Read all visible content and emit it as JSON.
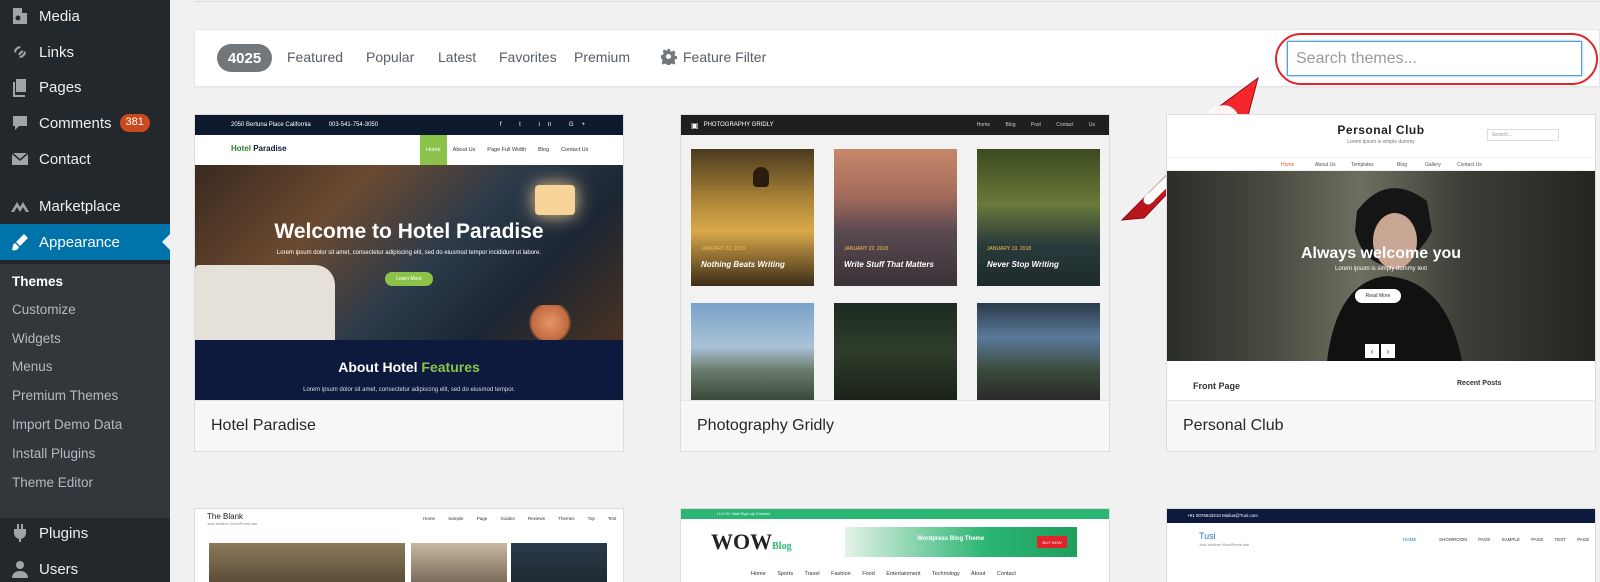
{
  "sidebar": {
    "items": [
      {
        "label": "Media",
        "icon": "media-icon"
      },
      {
        "label": "Links",
        "icon": "link-icon"
      },
      {
        "label": "Pages",
        "icon": "pages-icon"
      },
      {
        "label": "Comments",
        "icon": "comment-icon",
        "badge": "381"
      },
      {
        "label": "Contact",
        "icon": "mail-icon"
      },
      {
        "label": "Marketplace",
        "icon": "marketplace-icon"
      },
      {
        "label": "Appearance",
        "icon": "brush-icon"
      },
      {
        "label": "Plugins",
        "icon": "plugin-icon"
      },
      {
        "label": "Users",
        "icon": "user-icon"
      }
    ],
    "appearance_submenu": [
      "Themes",
      "Customize",
      "Widgets",
      "Menus",
      "Premium Themes",
      "Import Demo Data",
      "Install Plugins",
      "Theme Editor"
    ]
  },
  "filterbar": {
    "count": "4025",
    "tabs": [
      "Featured",
      "Popular",
      "Latest",
      "Favorites",
      "Premium"
    ],
    "feature_filter": "Feature Filter",
    "search_placeholder": "Search themes..."
  },
  "colors": {
    "sidebar_bg": "#23282d",
    "accent": "#0073aa",
    "badge": "#ca4a1f",
    "annotation_red": "#e2242a"
  },
  "themes": [
    {
      "name": "Hotel Paradise",
      "preview": {
        "topbar_address": "2050 Bertuna Place California",
        "topbar_phone": "003-541-754-3050",
        "social": "f t in G+",
        "logo_a": "Hotel",
        "logo_b": " Paradise",
        "nav": [
          "Home",
          "About Us",
          "Page Full Width",
          "Blog",
          "Contact Us"
        ],
        "hero_title": "Welcome to Hotel Paradise",
        "hero_text": "Lorem ipsum dolor sit amet, consectetur adipiscing elit, sed do eiusmod tempor incididunt ut labore.",
        "hero_button": "Learn More",
        "about_title_a": "About Hotel ",
        "about_title_b": "Features",
        "about_text": "Lorem ipsum dolor sit amet, consectetur adipiscing elit, sed do eiusmod tempor."
      }
    },
    {
      "name": "Photography Gridly",
      "preview": {
        "brand": "PHOTOGRAPHY GRIDLY",
        "nav": "Home Blog Post Contact Us",
        "tiles": [
          {
            "date": "JANUARY 22, 2018",
            "title": "Nothing Beats Writing"
          },
          {
            "date": "JANUARY 22, 2018",
            "title": "Write Stuff That Matters"
          },
          {
            "date": "JANUARY 19, 2018",
            "title": "Never Stop Writing"
          }
        ]
      }
    },
    {
      "name": "Personal Club",
      "preview": {
        "title": "Personal Club",
        "tagline": "Lorem ipsum is simple dummy",
        "search": "Search...",
        "nav": [
          "Home",
          "About Us",
          "Templates",
          "Blog",
          "Gallery",
          "Contact Us"
        ],
        "hero_title": "Always welcome you",
        "hero_text": "Lorem ipsum is simply dummy text",
        "hero_button": "Read More",
        "front_page": "Front Page",
        "recent_posts": "Recent Posts"
      }
    }
  ],
  "row2": [
    {
      "logo": "The Blank",
      "tagline": "Just another WordPress site",
      "nav": "Home Sample Page Guides Reviews Themes Top Test"
    },
    {
      "topbar": "f t in G+ Mail Sign Up Contact",
      "logo": "WOW",
      "logo_badge": "Blog",
      "banner": "Wordpress Blog Theme",
      "banner_button": "BUY NOW",
      "nav": "Home Sports Travel Fashion Food Entertainment Technology About Contact"
    },
    {
      "topbar": "+91 0076543210   Mailus@Tusi.com",
      "logo": "Tusi",
      "tagline": "Just another WordPress site",
      "nav_active": "HOME",
      "nav": "SHOWROOM PAGE   SAMPLE PAGE   TEST PAGE"
    }
  ]
}
